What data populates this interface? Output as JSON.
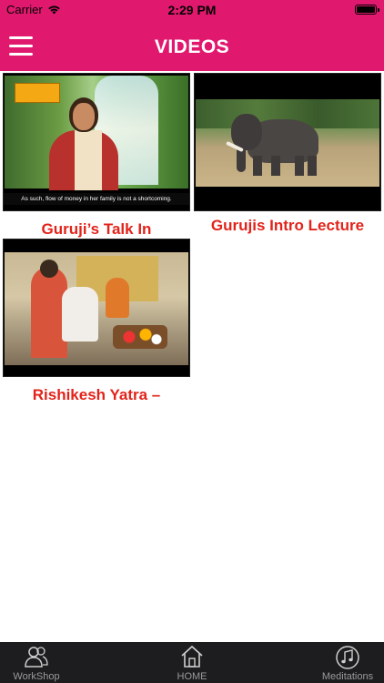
{
  "status_bar": {
    "carrier": "Carrier",
    "time": "2:29 PM",
    "wifi_icon": "wifi-icon",
    "battery_icon": "battery-icon"
  },
  "header": {
    "title": "VIDEOS",
    "menu_icon": "hamburger-menu-icon",
    "background": "#e0196f"
  },
  "videos": [
    {
      "title": "Guruji’s Talk In",
      "subtitle": "As such, flow of money in her family is not a shortcoming."
    },
    {
      "title": "Gurujis Intro Lecture"
    },
    {
      "title": "Rishikesh Yatra –"
    }
  ],
  "tabbar": {
    "tabs": [
      {
        "label": "WorkShop",
        "icon": "people-icon"
      },
      {
        "label": "HOME",
        "icon": "home-icon"
      },
      {
        "label": "Meditations",
        "icon": "music-note-icon"
      }
    ]
  },
  "colors": {
    "accent": "#e0196f",
    "title_text": "#e2231a",
    "tabbar_bg": "#1d1d1f"
  }
}
